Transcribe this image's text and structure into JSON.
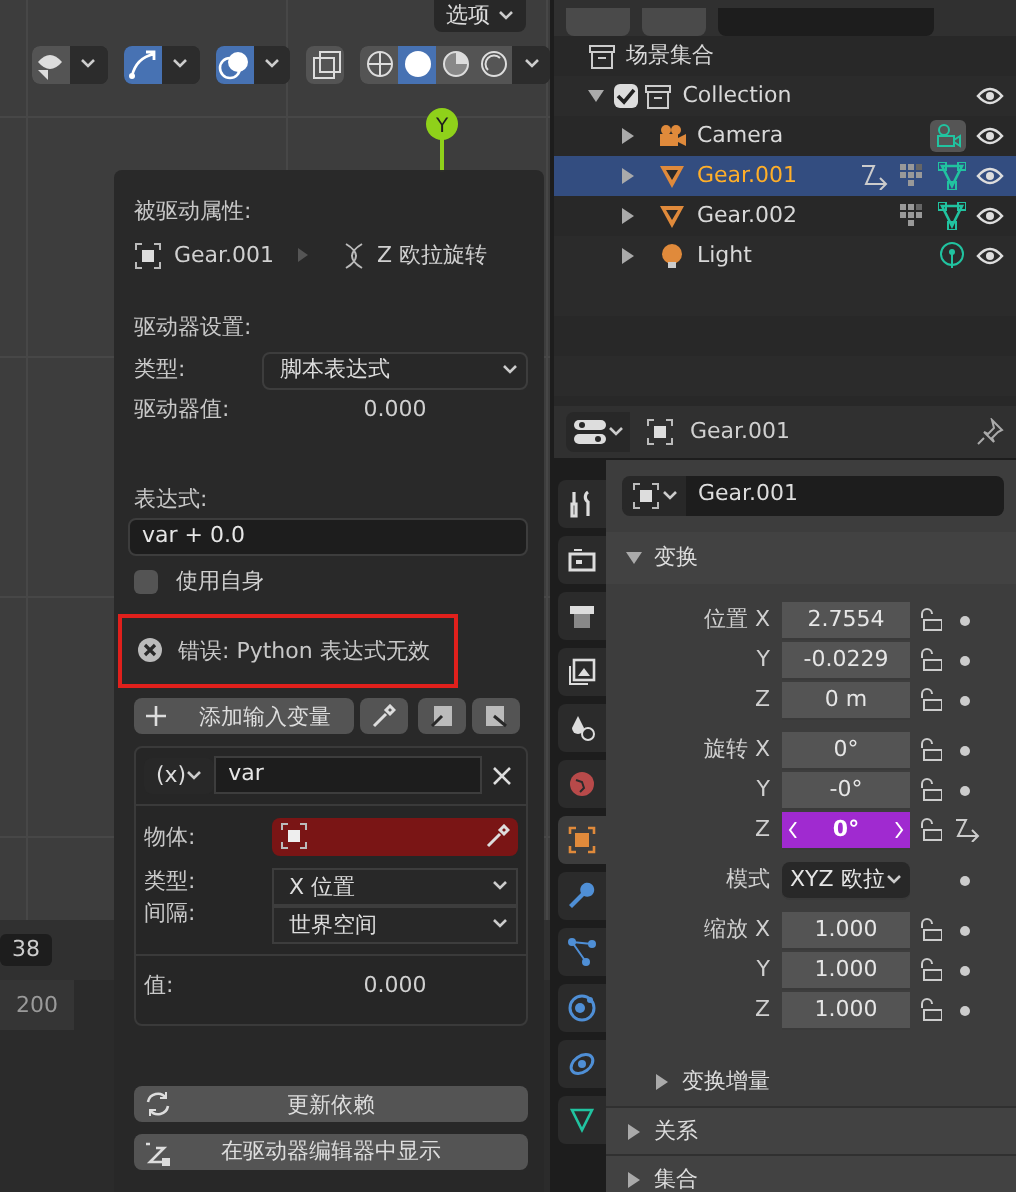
{
  "viewport": {
    "options_label": "选项",
    "toggles": [
      {
        "kind": "visibility",
        "on": false
      },
      {
        "kind": "gizmo",
        "on": true
      },
      {
        "kind": "overlay",
        "on": true
      },
      {
        "kind": "xray",
        "on": false
      }
    ],
    "shading": [
      {
        "kind": "wireframe",
        "selected": false
      },
      {
        "kind": "solid",
        "selected": true
      },
      {
        "kind": "material",
        "selected": false
      },
      {
        "kind": "rendered",
        "selected": false
      }
    ],
    "axis_label": "Y"
  },
  "timeline": {
    "frame": "38",
    "tick": "200"
  },
  "driver_popup": {
    "driven_heading": "被驱动属性:",
    "object_name": "Gear.001",
    "property": "Z 欧拉旋转",
    "settings_heading": "驱动器设置:",
    "type_label": "类型:",
    "type_value": "脚本表达式",
    "value_label": "驱动器值:",
    "value": "0.000",
    "expression_heading": "表达式:",
    "expression": "var + 0.0",
    "use_self": {
      "label": "使用自身",
      "checked": false
    },
    "error": {
      "text": "错误: Python 表达式无效",
      "highlighted": true
    },
    "add_variable": "添加输入变量",
    "variable": {
      "type_symbol": "(x)",
      "name": "var",
      "object_label": "物体:",
      "type_label": "类型:",
      "type_value": "X 位置",
      "space_label": "间隔:",
      "space_value": "世界空间",
      "value_label": "值:",
      "value": "0.000"
    },
    "update_button": "更新依赖",
    "show_button": "在驱动器编辑器中显示"
  },
  "outliner": {
    "root": "场景集合",
    "collection": {
      "name": "Collection",
      "checked": true,
      "expanded": true
    },
    "objects": [
      {
        "name": "Camera",
        "kind": "camera",
        "selected": false,
        "badges": [
          {
            "kind": "camera_data"
          }
        ]
      },
      {
        "name": "Gear.001",
        "kind": "mesh",
        "selected": true,
        "badges": [
          {
            "kind": "driver"
          },
          {
            "kind": "modifier"
          },
          {
            "kind": "mesh_data"
          }
        ]
      },
      {
        "name": "Gear.002",
        "kind": "mesh",
        "selected": false,
        "badges": [
          {
            "kind": "modifier"
          },
          {
            "kind": "mesh_data"
          }
        ]
      },
      {
        "name": "Light",
        "kind": "light",
        "selected": false,
        "badges": [
          {
            "kind": "light_data"
          }
        ]
      }
    ]
  },
  "properties": {
    "header_name": "Gear.001",
    "object_name": "Gear.001",
    "tabs": [
      {
        "kind": "tool",
        "selected": false
      },
      {
        "kind": "render",
        "selected": false
      },
      {
        "kind": "output",
        "selected": false
      },
      {
        "kind": "view_layer",
        "selected": false
      },
      {
        "kind": "scene",
        "selected": false
      },
      {
        "kind": "world",
        "selected": false
      },
      {
        "kind": "object",
        "selected": true
      },
      {
        "kind": "modifier",
        "selected": false
      },
      {
        "kind": "particles",
        "selected": false
      },
      {
        "kind": "physics",
        "selected": false
      },
      {
        "kind": "constraints",
        "selected": false
      },
      {
        "kind": "data",
        "selected": false
      }
    ],
    "panel": {
      "title": "变换",
      "expanded": true,
      "rows": [
        {
          "label": "位置 X",
          "value": "2.7554",
          "kind": "number"
        },
        {
          "label": "Y",
          "value": "-0.0229",
          "kind": "number"
        },
        {
          "label": "Z",
          "value": "0 m",
          "kind": "number"
        },
        {
          "label": "旋转 X",
          "value": "0°",
          "kind": "number"
        },
        {
          "label": "Y",
          "value": "-0°",
          "kind": "number"
        },
        {
          "label": "Z",
          "value": "0°",
          "kind": "driven"
        },
        {
          "label": "模式",
          "value": "XYZ 欧拉",
          "kind": "dropdown"
        },
        {
          "label": "缩放 X",
          "value": "1.000",
          "kind": "number"
        },
        {
          "label": "Y",
          "value": "1.000",
          "kind": "number"
        },
        {
          "label": "Z",
          "value": "1.000",
          "kind": "number"
        }
      ]
    },
    "collapsed": [
      {
        "label": "变换增量",
        "kind": "subpanel",
        "expanded": false
      },
      {
        "label": "关系",
        "kind": "panel",
        "expanded": false
      },
      {
        "label": "集合",
        "kind": "panel",
        "expanded": false
      }
    ]
  }
}
